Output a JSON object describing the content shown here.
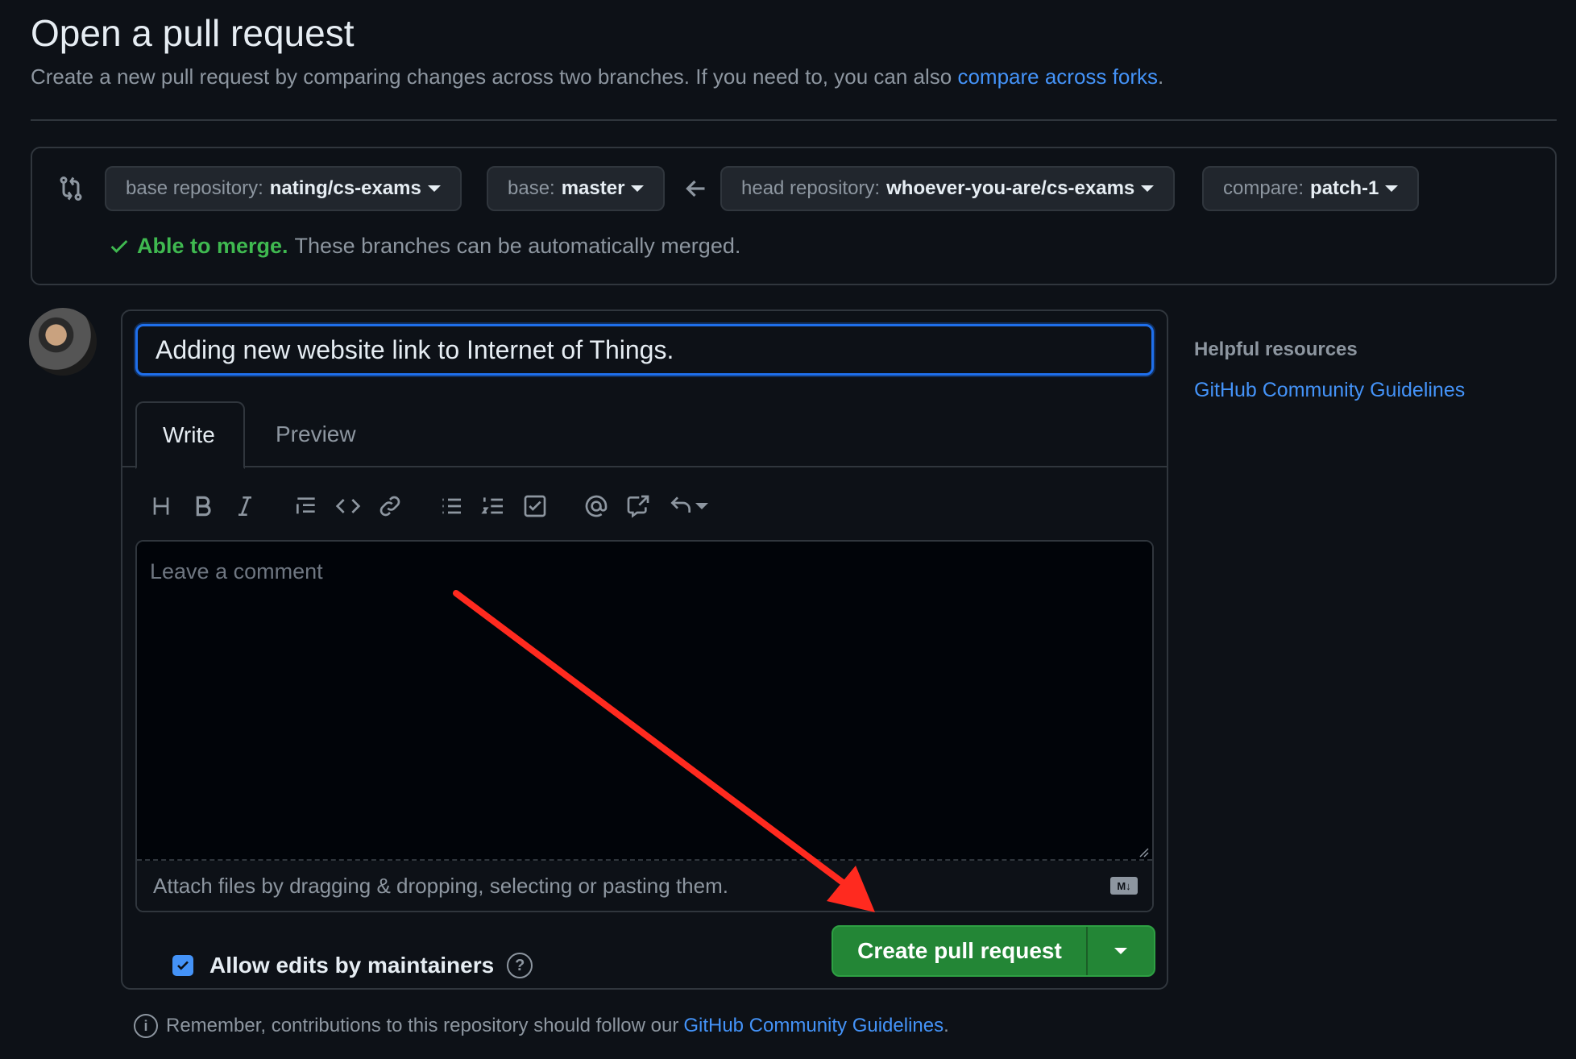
{
  "header": {
    "title": "Open a pull request",
    "subtitle": "Create a new pull request by comparing changes across two branches. If you need to, you can also",
    "forks_link": "compare across forks",
    "subtitle_end": "."
  },
  "compare": {
    "base_repo_label": "base repository:",
    "base_repo_value": "nating/cs-exams",
    "base_label": "base:",
    "base_value": "master",
    "head_repo_label": "head repository:",
    "head_repo_value": "whoever-you-are/cs-exams",
    "compare_label": "compare:",
    "compare_value": "patch-1",
    "merge_ok": "Able to merge.",
    "merge_text": "These branches can be automatically merged."
  },
  "form": {
    "title_value": "Adding new website link to Internet of Things.",
    "tab_write": "Write",
    "tab_preview": "Preview",
    "toolbar": [
      "heading-icon",
      "bold-icon",
      "italic-icon",
      "quote-icon",
      "code-icon",
      "link-icon",
      "unordered-list-icon",
      "ordered-list-icon",
      "task-list-icon",
      "mention-icon",
      "reference-icon",
      "reply-icon"
    ],
    "comment_placeholder": "Leave a comment",
    "attach_text": "Attach files by dragging & dropping, selecting or pasting them.",
    "allow_edits": "Allow edits by maintainers",
    "create_button": "Create pull request"
  },
  "sidebar": {
    "heading": "Helpful resources",
    "link": "GitHub Community Guidelines"
  },
  "footer": {
    "text": "Remember, contributions to this repository should follow our",
    "link": "GitHub Community Guidelines",
    "end": "."
  },
  "colors": {
    "background": "#0d1117",
    "accent_link": "#4493f8",
    "success": "#3fb950",
    "primary_button": "#238636",
    "annotation_arrow": "#ff2a1f"
  }
}
